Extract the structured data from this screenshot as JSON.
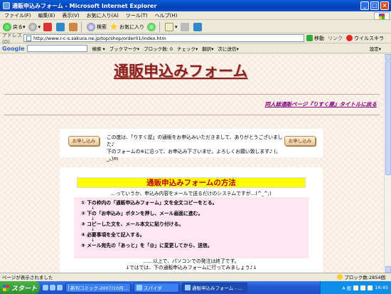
{
  "window": {
    "title": "通販申込みフォーム - Microsoft Internet Explorer"
  },
  "menu": [
    "ファイル(F)",
    "編集(E)",
    "表示(V)",
    "お気に入り(A)",
    "ツール(T)",
    "ヘルプ(H)"
  ],
  "toolbar": {
    "back": "戻る",
    "search": "検索",
    "favorites": "お気に入り"
  },
  "address": {
    "label": "アドレス(D)",
    "url": "http://www.r-c-s.sakura.ne.jp/top/shop/order01/index.htm",
    "go": "移動",
    "links": "リンク",
    "virus": "ウイルスキラ"
  },
  "google": {
    "logo": "Google",
    "search_label": "検索",
    "bookmarks": "ブックマーク",
    "blocked": "ブロック数: 0",
    "check": "チェック",
    "translate": "翻訳",
    "send": "次に送信",
    "settings": "設定"
  },
  "page": {
    "title": "通販申込みフォーム",
    "back_link": "同人誌通販ページ『りすく屋』タイトルに戻る",
    "apply_button": "お申し込み",
    "intro_line1": "この度は、「りすく屋」の通販をお申込みいただきまして、ありがとうございました♪",
    "intro_line2": "下のフォームの※に沿って、お申込み下さいませ。よろしくお願い致します♪ (。_。)m",
    "method_title": "通販申込みフォームの方法",
    "method_sub": "…っていうか、申込み内容をメールで送るだけのシステムですが…(^_^;)",
    "steps": [
      "① 下の枠内の「通販申込みフォーム」文を全文コピーをとる。",
      "② 下の「お申込み」ボタンを押し、メール画面に進む。",
      "③ コピーした文を、メール本文に貼り付ける。",
      "④ 必要事項を全て記入する。",
      "⑤ メール宛先の「あっと」を「@」に変更してから、送信。"
    ],
    "step_arrow": "↓",
    "outro_line1": "……以上で、パソコンでの発注は終了です。",
    "outro_line2": "↓ではでは、下の通販申込みフォームに行ってみましょう♪↓"
  },
  "status": {
    "text": "ページが表示されました",
    "blocked": "ブロック数:2854個"
  },
  "taskbar": {
    "start": "スタート",
    "tasks": [
      "新刊コミック-2007/10月...",
      "スパイダ",
      "通販申込みフォーム - ..."
    ],
    "clock": "16:45",
    "ime": "A 般"
  }
}
